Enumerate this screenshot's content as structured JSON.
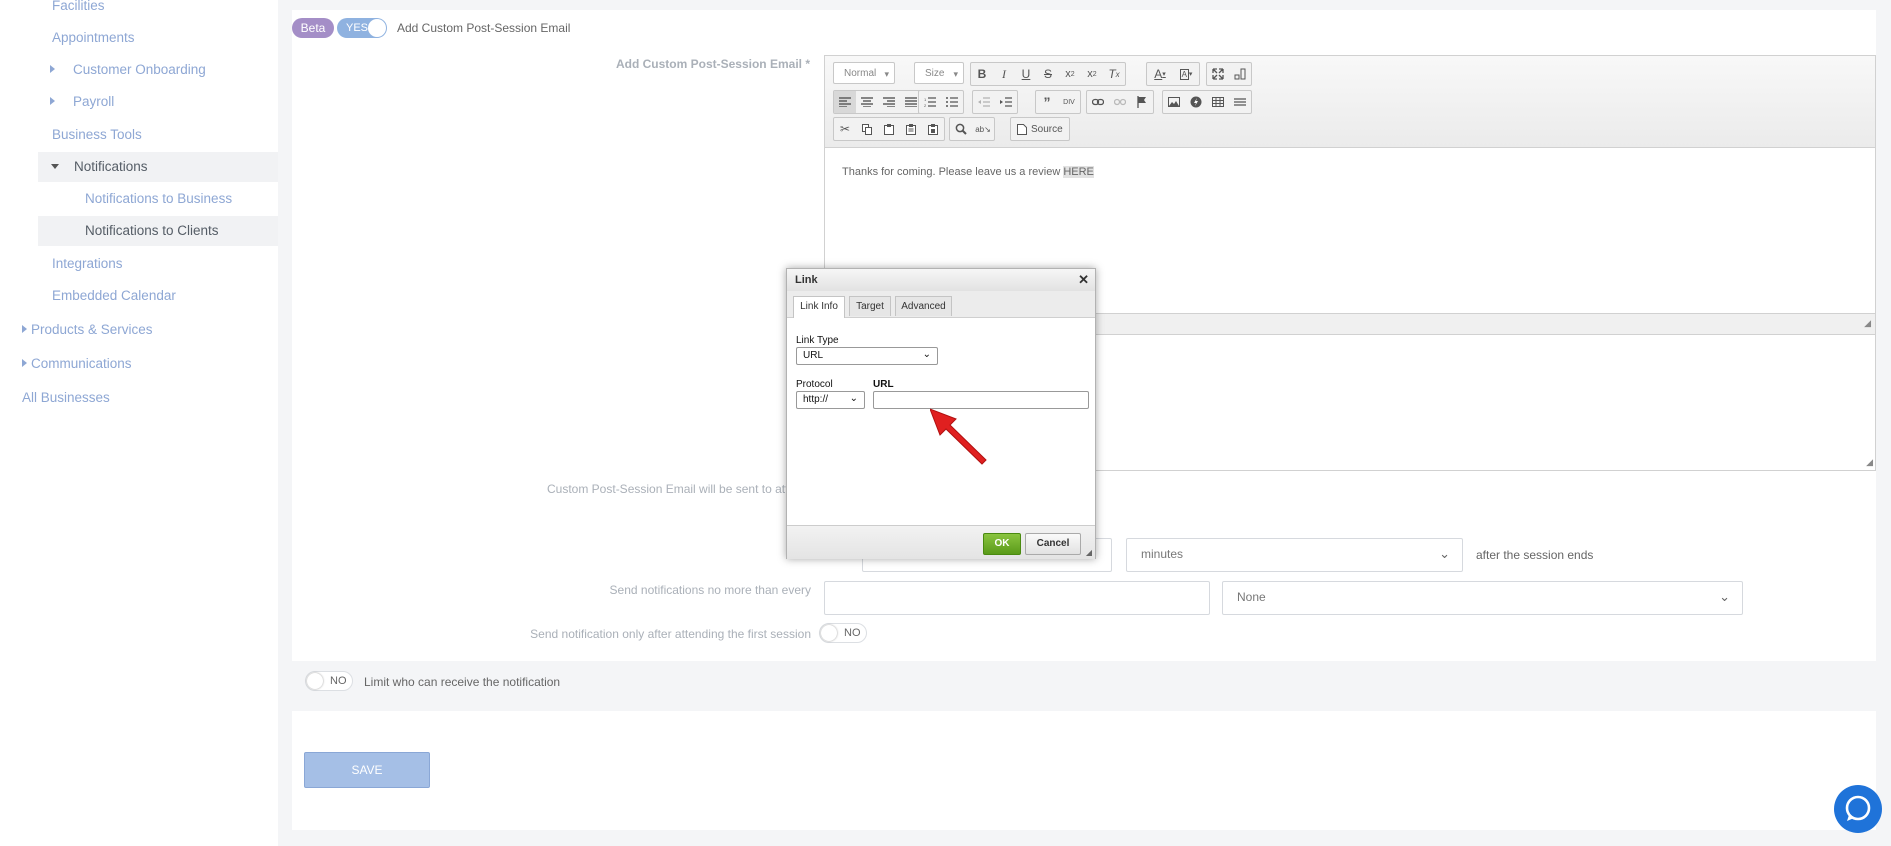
{
  "sidebar": {
    "items": [
      {
        "label": "Facilities"
      },
      {
        "label": "Appointments"
      },
      {
        "label": "Customer Onboarding"
      },
      {
        "label": "Payroll"
      },
      {
        "label": "Business Tools"
      },
      {
        "label": "Notifications"
      },
      {
        "label": "Notifications to Business"
      },
      {
        "label": "Notifications to Clients"
      },
      {
        "label": "Integrations"
      },
      {
        "label": "Embedded Calendar"
      },
      {
        "label": "Products & Services"
      },
      {
        "label": "Communications"
      },
      {
        "label": "All Businesses"
      }
    ]
  },
  "header": {
    "beta_badge": "Beta",
    "toggle_label": "YES",
    "title": "Add Custom Post-Session Email"
  },
  "editor": {
    "label": "Add Custom Post-Session Email *",
    "format_combo": "Normal",
    "size_combo": "Size",
    "source_label": "Source",
    "content_text": "Thanks for coming. Please leave us a review ",
    "content_link": "HERE"
  },
  "form": {
    "sent_to_label": "Custom Post-Session Email will be sent to attend",
    "unit_value": "minutes",
    "after_label": "after the session ends",
    "frequency_label": "Send notifications no more than every",
    "frequency_unit_value": "None",
    "first_session_label": "Send notification only after attending the first session",
    "first_session_toggle": "NO",
    "limit_toggle": "NO",
    "limit_label": "Limit who can receive the notification",
    "save_label": "SAVE"
  },
  "dialog": {
    "title": "Link",
    "tabs": [
      "Link Info",
      "Target",
      "Advanced"
    ],
    "link_type_label": "Link Type",
    "link_type_value": "URL",
    "protocol_label": "Protocol",
    "protocol_value": "http://",
    "url_label": "URL",
    "ok_label": "OK",
    "cancel_label": "Cancel"
  },
  "colors": {
    "accent": "#8ea7d4",
    "ok_button": "#6aad26",
    "save_button": "#a5bfe6",
    "arrow": "#e02020",
    "chat_button": "#1f73d9"
  }
}
